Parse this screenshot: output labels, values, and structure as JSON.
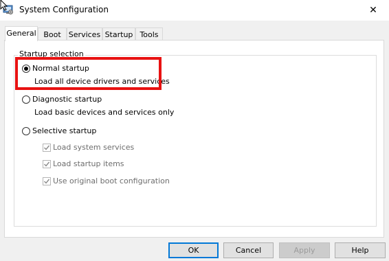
{
  "window": {
    "title": "System Configuration",
    "close_glyph": "✕"
  },
  "tabs": [
    {
      "label": "General",
      "active": true
    },
    {
      "label": "Boot",
      "active": false
    },
    {
      "label": "Services",
      "active": false
    },
    {
      "label": "Startup",
      "active": false
    },
    {
      "label": "Tools",
      "active": false
    }
  ],
  "startup_selection": {
    "group_label": "Startup selection",
    "normal": {
      "label": "Normal startup",
      "description": "Load all device drivers and services",
      "selected": true
    },
    "diagnostic": {
      "label": "Diagnostic startup",
      "description": "Load basic devices and services only",
      "selected": false
    },
    "selective": {
      "label": "Selective startup",
      "selected": false,
      "options": [
        {
          "label": "Load system services",
          "checked": true,
          "enabled": false
        },
        {
          "label": "Load startup items",
          "checked": true,
          "enabled": false
        },
        {
          "label": "Use original boot configuration",
          "checked": true,
          "enabled": false
        }
      ]
    }
  },
  "buttons": {
    "ok": "OK",
    "cancel": "Cancel",
    "apply": "Apply",
    "help": "Help"
  },
  "colors": {
    "highlight": "#e81212",
    "accent": "#0078d7"
  }
}
